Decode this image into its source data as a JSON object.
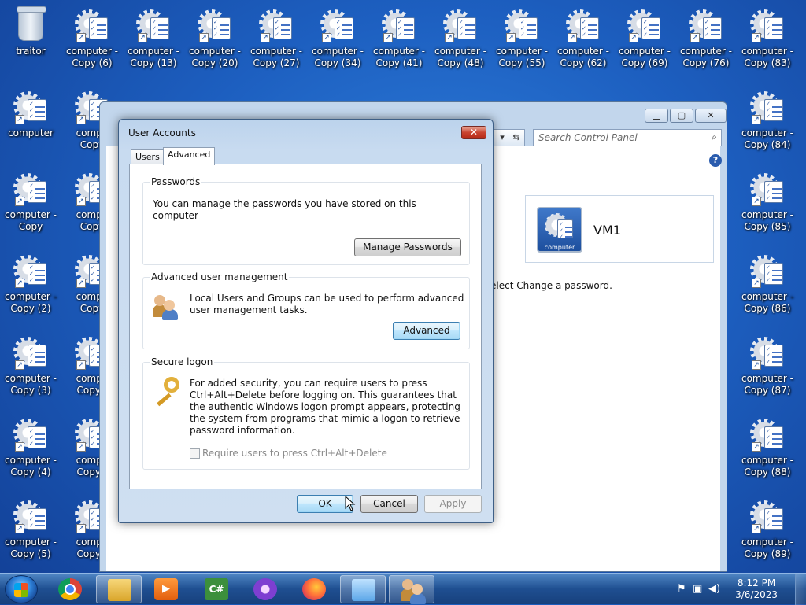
{
  "desktop": {
    "icons": [
      {
        "label": "traitor",
        "type": "recycle-bin"
      },
      {
        "label": "computer -\nCopy (6)",
        "type": "shortcut"
      },
      {
        "label": "computer -\nCopy (13)",
        "type": "shortcut"
      },
      {
        "label": "computer -\nCopy (20)",
        "type": "shortcut"
      },
      {
        "label": "computer -\nCopy (27)",
        "type": "shortcut"
      },
      {
        "label": "computer -\nCopy (34)",
        "type": "shortcut"
      },
      {
        "label": "computer -\nCopy (41)",
        "type": "shortcut"
      },
      {
        "label": "computer -\nCopy (48)",
        "type": "shortcut"
      },
      {
        "label": "computer -\nCopy (55)",
        "type": "shortcut"
      },
      {
        "label": "computer -\nCopy (62)",
        "type": "shortcut"
      },
      {
        "label": "computer -\nCopy (69)",
        "type": "shortcut"
      },
      {
        "label": "computer -\nCopy (76)",
        "type": "shortcut"
      },
      {
        "label": "computer -\nCopy (83)",
        "type": "shortcut"
      },
      {
        "label": "computer",
        "type": "shortcut"
      },
      {
        "label": "computer -\nCopy",
        "type": "shortcut"
      },
      {
        "label": "computer -\nCopy (2)",
        "type": "shortcut"
      },
      {
        "label": "computer -\nCopy (3)",
        "type": "shortcut"
      },
      {
        "label": "computer -\nCopy (4)",
        "type": "shortcut"
      },
      {
        "label": "computer -\nCopy (5)",
        "type": "shortcut"
      },
      {
        "label": "computer -\nCopy (84)",
        "type": "shortcut"
      },
      {
        "label": "computer -\nCopy (85)",
        "type": "shortcut"
      },
      {
        "label": "computer -\nCopy (86)",
        "type": "shortcut"
      },
      {
        "label": "computer -\nCopy (87)",
        "type": "shortcut"
      },
      {
        "label": "computer -\nCopy (88)",
        "type": "shortcut"
      },
      {
        "label": "computer -\nCopy (89)",
        "type": "shortcut"
      },
      {
        "label": "compu\nCopy",
        "type": "shortcut"
      },
      {
        "label": "compu\nCopy",
        "type": "shortcut"
      },
      {
        "label": "compu\nCopy",
        "type": "shortcut"
      },
      {
        "label": "compu\nCopy (",
        "type": "shortcut"
      },
      {
        "label": "compu\nCopy (",
        "type": "shortcut"
      },
      {
        "label": "compu\nCopy (",
        "type": "shortcut"
      }
    ]
  },
  "control_panel": {
    "search_placeholder": "Search Control Panel",
    "account_name": "VM1",
    "account_pic_label": "computer",
    "partial_text": "elect Change a password.",
    "help_glyph": "?"
  },
  "dialog": {
    "title": "User Accounts",
    "close_glyph": "✕",
    "tabs": [
      "Users",
      "Advanced"
    ],
    "active_tab": "Advanced",
    "passwords": {
      "title": "Passwords",
      "text": "You can manage the passwords you have stored on this computer",
      "button": "Manage Passwords"
    },
    "advanced_management": {
      "title": "Advanced user management",
      "text": "Local Users and Groups can be used to perform advanced user management tasks.",
      "button": "Advanced"
    },
    "secure_logon": {
      "title": "Secure logon",
      "text": "For added security, you can require users to press Ctrl+Alt+Delete before logging on. This guarantees that the authentic Windows logon prompt appears, protecting the system from programs that mimic a logon to retrieve password information.",
      "checkbox_label": "Require users to press Ctrl+Alt+Delete",
      "checkbox_checked": false
    },
    "buttons": {
      "ok": "OK",
      "cancel": "Cancel",
      "apply": "Apply"
    }
  },
  "taskbar": {
    "apps": [
      {
        "name": "windows-explorer",
        "open": true
      },
      {
        "name": "chrome",
        "open": false
      },
      {
        "name": "media-player",
        "open": false
      },
      {
        "name": "csharp-editor",
        "open": false
      },
      {
        "name": "tor-browser",
        "open": false
      },
      {
        "name": "firefox",
        "open": false
      },
      {
        "name": "control-panel",
        "open": true
      },
      {
        "name": "user-accounts",
        "open": true
      }
    ],
    "csharp_glyph": "C#",
    "time": "8:12 PM",
    "date": "3/6/2023"
  },
  "colors": {
    "desktop_bg": "#1d5fc0",
    "dialog_frame": "#c8dbf0",
    "close_red": "#c9432f",
    "taskbar": "#1f4f91"
  }
}
